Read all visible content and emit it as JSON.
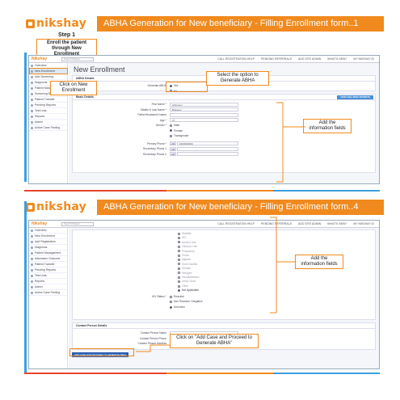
{
  "slide1": {
    "logo": "nikshay",
    "title": "ABHA Generation for New beneficiary  - Filling Enrollment form..1",
    "step": {
      "number": "Step 1",
      "description": "Enroll the patient through New Enrollment"
    },
    "app": {
      "brand": "Nikshay",
      "search_placeholder": "Search Patient",
      "top_links": [
        "CALL REGISTRATION HELP",
        "PENDING REFERRALS",
        "ADD SITE ADMIN",
        "WHAT'S NEW?",
        "MY NIKSHAY ID"
      ],
      "sidebar": [
        "Overview",
        "New Enrollment",
        "Add Screening",
        "Diagnosis",
        "Patient Management",
        "Screening Dashboard",
        "Patient Transfer",
        "Pending Reports",
        "Test Lists",
        "Reports",
        "Admin",
        "Active Case Finding"
      ],
      "page_title": "New Enrollment",
      "abha_section": {
        "header": "ABHA Details",
        "question": "Generate ABHA",
        "options": [
          "Yes",
          "No"
        ],
        "selected": "Yes"
      },
      "basic_section": {
        "header": "Basic Details",
        "button": "VIEW HIGH RISK PATIENTS",
        "fields": [
          {
            "label": "First Name *",
            "value": "Abhimuni"
          },
          {
            "label": "Middle & Last Name *",
            "value": "Bhawani"
          },
          {
            "label": "Father/Husband's Name",
            "value": ""
          },
          {
            "label": "Age *",
            "value": "37"
          }
        ],
        "gender_label": "Gender *",
        "gender_options": [
          "Male",
          "Female",
          "Transgender"
        ],
        "gender_selected": "Female",
        "phone_fields": [
          {
            "label": "Primary Phone *",
            "prefix": "+91",
            "value": "9100000000"
          },
          {
            "label": "Secondary Phone 1",
            "prefix": "+91",
            "value": ""
          },
          {
            "label": "Secondary Phone 2",
            "prefix": "+91",
            "value": ""
          }
        ]
      }
    },
    "callouts": {
      "new_enrollment": "Click on New Enrollment",
      "select_option": "Select the option to Generate ABHA",
      "add_info": "Add the information fields"
    }
  },
  "slide2": {
    "logo": "nikshay",
    "title": "ABHA Generation for New beneficiary  - Filling Enrollment form..4",
    "app": {
      "brand": "Nikshay",
      "search_placeholder": "Search Patient",
      "top_links": [
        "CALL REGISTRATION HELP",
        "PENDING REFERRALS",
        "ADD SITE ADMIN",
        "WHAT'S NEW?",
        "MY NIKSHAY ID"
      ],
      "sidebar": [
        "Overview",
        "New Enrollment",
        "Add Registration",
        "Diagnosis",
        "Patient Management",
        "Admission Outcome",
        "Patient Transfer",
        "Pending Reports",
        "Test Lists",
        "Reports",
        "Admin",
        "Active Case Finding"
      ],
      "options": [
        "Diabetic",
        "HIV",
        "Alcohol Use",
        "Tobacco Use",
        "Pregnancy",
        "Prison",
        "Migrant",
        "Slum Dweller",
        "Smoker",
        "Refugee",
        "Hospitalization",
        "Urban Slum",
        "Other",
        "Not Applicable"
      ],
      "selected_option": "Not Applicable",
      "hiv_label": "HIV Status *",
      "hiv_options": [
        "Reactive",
        "Non Reactive / Negative",
        "Unknown"
      ],
      "hiv_selected": "Unknown",
      "contact_section": {
        "header": "Contact Person Details",
        "fields": [
          {
            "label": "Contact Person Name",
            "value": ""
          },
          {
            "label": "Contact Person Phone",
            "prefix": "+91",
            "value": ""
          },
          {
            "label": "Contact Person Address",
            "value": ""
          }
        ]
      },
      "submit_button": "ADD CASE AND PROCEED TO GENERATE ABHA"
    },
    "callouts": {
      "add_info": "Add the information fields",
      "add_case": "Click on \"Add Case and Proceed to Generate ABHA\""
    }
  },
  "colors": {
    "accent": "#f08a1e",
    "info_blue": "#3b9fe0",
    "button_blue": "#4a8fd4"
  }
}
